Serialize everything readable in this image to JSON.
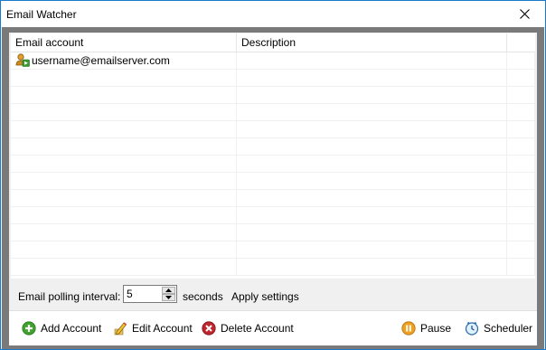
{
  "window": {
    "title": "Email Watcher"
  },
  "list": {
    "columns": [
      "Email account",
      "Description",
      ""
    ],
    "rows": [
      {
        "account": "username@emailserver.com",
        "description": "",
        "extra": ""
      }
    ],
    "empty_rows": 12
  },
  "settings": {
    "polling_label": "Email polling interval:",
    "polling_value": "5",
    "seconds_label": "seconds",
    "apply_label": "Apply settings"
  },
  "toolbar": {
    "add_label": "Add Account",
    "edit_label": "Edit Account",
    "delete_label": "Delete Account",
    "pause_label": "Pause",
    "scheduler_label": "Scheduler"
  },
  "colors": {
    "accent": "#1979ca",
    "add_icon": "#3ea22c",
    "delete_icon": "#c0262e",
    "pause_icon": "#f0a020"
  }
}
